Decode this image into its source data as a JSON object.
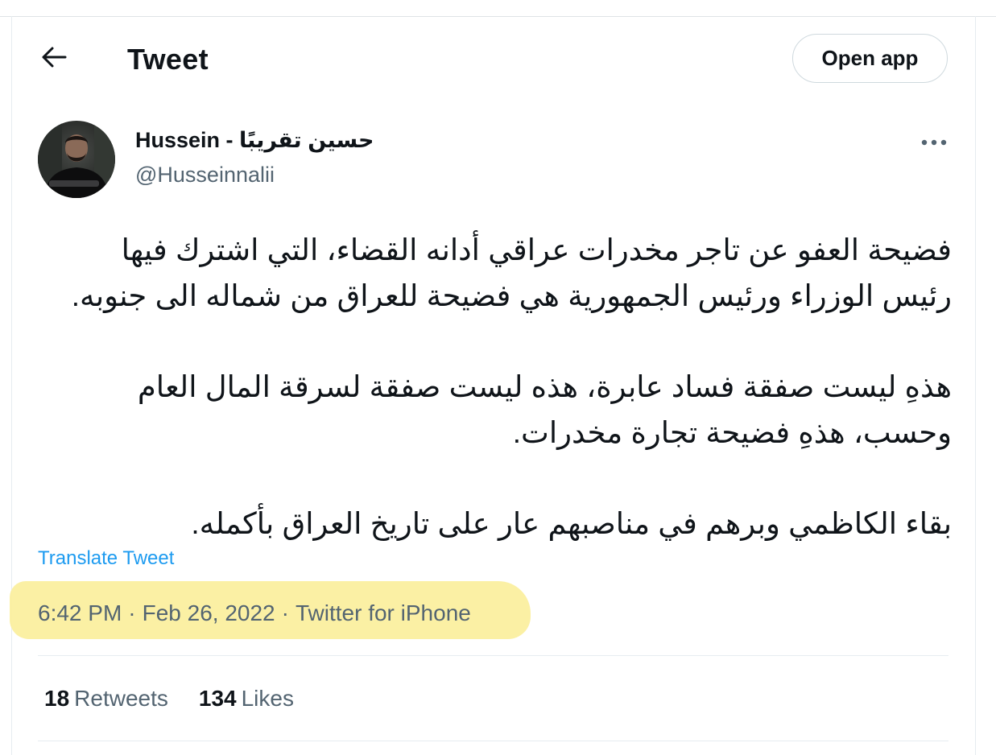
{
  "header": {
    "title": "Tweet",
    "open_app_label": "Open app"
  },
  "icons": {
    "back": "arrow-left-icon",
    "more": "more-horizontal-icon"
  },
  "author": {
    "name": "Hussein - حسين تقريبًا",
    "handle": "@Husseinnalii"
  },
  "tweet": {
    "paragraphs": [
      [
        "فضيحة العفو عن تاجر مخدرات عراقي أدانه القضاء، التي اشترك فيها",
        "رئيس الوزراء ورئيس الجمهورية هي فضيحة للعراق من شماله الى جنوبه."
      ],
      [
        "هذهِ ليست صفقة فساد عابرة، هذه ليست صفقة لسرقة المال العام",
        "وحسب، هذهِ فضيحة تجارة مخدرات."
      ],
      [
        "بقاء الكاظمي وبرهم في مناصبهم عار على تاريخ العراق بأكمله."
      ]
    ],
    "translate_label": "Translate Tweet",
    "time": "6:42 PM",
    "date": "Feb 26, 2022",
    "source": "Twitter for iPhone",
    "separator": "·"
  },
  "stats": {
    "retweets_count": "18",
    "retweets_label": "Retweets",
    "likes_count": "134",
    "likes_label": "Likes"
  },
  "colors": {
    "link": "#1d9bf0",
    "secondary_text": "#536471",
    "highlight": "#fbee9a",
    "border": "#cfd9de"
  }
}
